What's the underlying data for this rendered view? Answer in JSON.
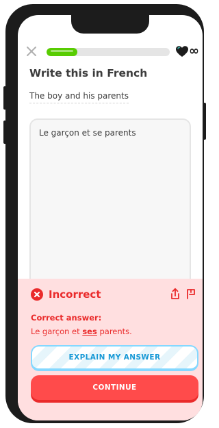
{
  "lesson": {
    "progress_fraction": 0.25,
    "hearts_count": "∞",
    "title": "Write this in French",
    "prompt": "The boy and his parents",
    "user_answer": "Le garçon et se parents"
  },
  "feedback": {
    "status": "Incorrect",
    "correct_label": "Correct answer:",
    "correct_answer_before": "Le garçon et ",
    "correct_answer_highlight": "ses",
    "correct_answer_after": " parents.",
    "explain_button": "EXPLAIN MY ANSWER",
    "continue_button": "CONTINUE"
  },
  "icons": {
    "close": "close-icon",
    "heart": "heart-icon",
    "incorrect": "x-circle-icon",
    "share": "share-icon",
    "report": "flag-icon"
  },
  "colors": {
    "progress": "#58cc02",
    "error": "#ea2b2b",
    "error_bg": "#ffdfe0",
    "continue": "#ff4b4b",
    "explain_text": "#1899d6",
    "explain_border": "#84d8ff"
  }
}
